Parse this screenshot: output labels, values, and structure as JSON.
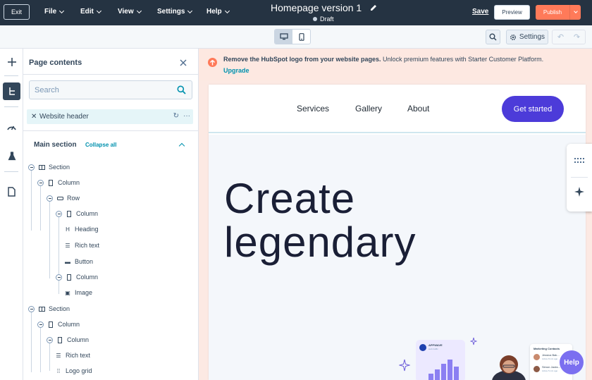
{
  "topbar": {
    "exit_label": "Exit",
    "menus": [
      "File",
      "Edit",
      "View",
      "Settings",
      "Help"
    ],
    "page_title": "Homepage version 1",
    "status": "Draft",
    "save_label": "Save",
    "preview_label": "Preview",
    "publish_label": "Publish"
  },
  "toolbar": {
    "settings_label": "Settings"
  },
  "panel": {
    "title": "Page contents",
    "search_placeholder": "Search",
    "header_item": "Website header",
    "section_label": "Main section",
    "collapse_all": "Collapse all",
    "tree": [
      {
        "label": "Section",
        "icon": "section-icon"
      },
      {
        "label": "Column",
        "icon": "column-icon"
      },
      {
        "label": "Row",
        "icon": "row-icon"
      },
      {
        "label": "Column",
        "icon": "column-icon"
      },
      {
        "label": "Heading",
        "icon": "heading-icon"
      },
      {
        "label": "Rich text",
        "icon": "rich-text-icon"
      },
      {
        "label": "Button",
        "icon": "button-icon"
      },
      {
        "label": "Column",
        "icon": "column-icon"
      },
      {
        "label": "Image",
        "icon": "image-icon"
      },
      {
        "label": "Section",
        "icon": "section-icon"
      },
      {
        "label": "Column",
        "icon": "column-icon"
      },
      {
        "label": "Column",
        "icon": "column-icon"
      },
      {
        "label": "Rich text",
        "icon": "rich-text-icon"
      },
      {
        "label": "Logo grid",
        "icon": "logo-grid-icon"
      }
    ]
  },
  "banner": {
    "bold_text": "Remove the HubSpot logo from your website pages.",
    "text": " Unlock premium features with Starter Customer Platform. ",
    "link": "Upgrade"
  },
  "site": {
    "nav": [
      "Services",
      "Gallery",
      "About"
    ],
    "cta": "Get started",
    "hero_title": "Create legendary",
    "app_name": "APPWAVE",
    "app_sub": "web traffic",
    "contacts_title": "Marketing Contacts",
    "contacts": [
      "Jessica Bak...",
      "Simon Jacks..."
    ],
    "contact_notes": [
      "Active 8 min ago",
      "Active 5 min ago"
    ]
  },
  "help_label": "Help",
  "colors": {
    "topbar": "#253342",
    "publish": "#ff7a59",
    "accent": "#0091ae",
    "cta": "#4c3bd9"
  }
}
